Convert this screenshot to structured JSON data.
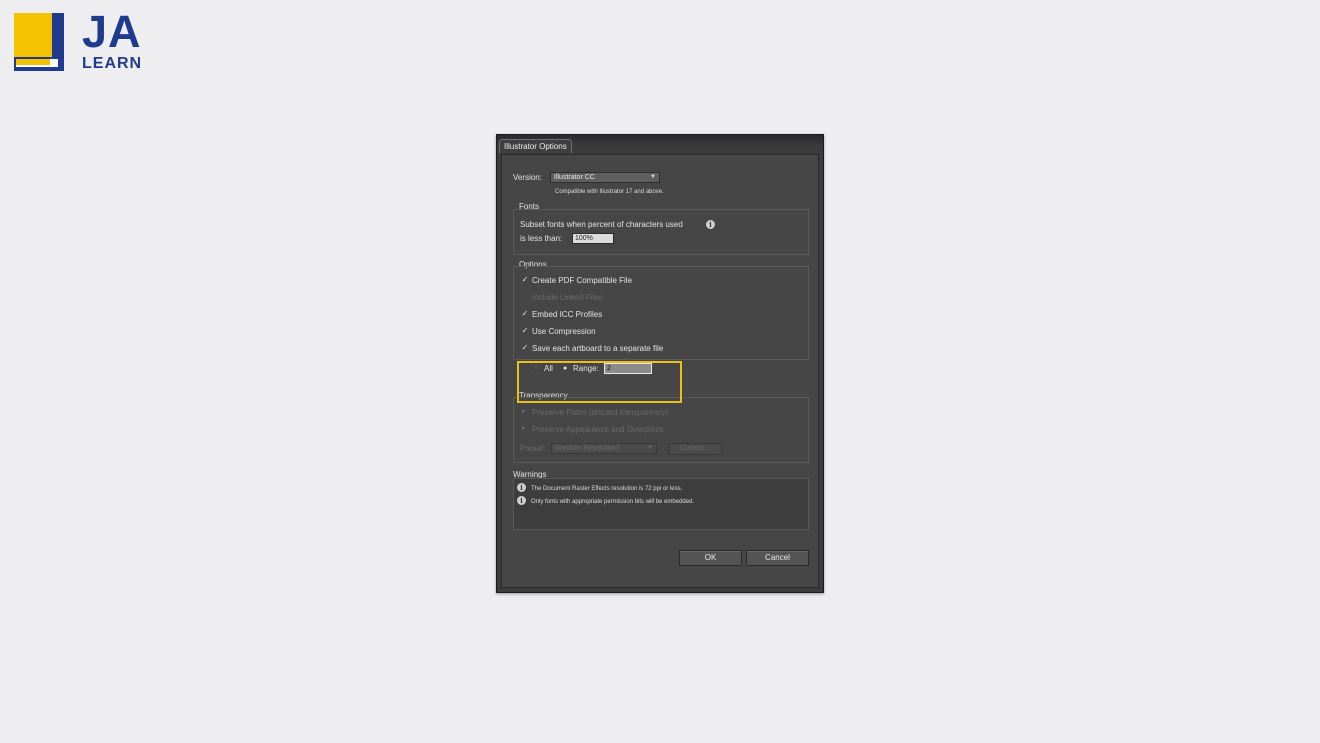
{
  "logo": {
    "ja": "JA",
    "learn": "LEARN",
    "colors": {
      "yellow": "#f5c200",
      "blue": "#1f3a8f"
    }
  },
  "dialog": {
    "title": "Illustrator Options",
    "version": {
      "label": "Version:",
      "selected": "Illustrator CC",
      "note": "Compatible with Illustrator 17 and above."
    },
    "fonts": {
      "group_label": "Fonts",
      "line1": "Subset fonts when percent of characters used",
      "line2": "is less than:",
      "value": "100%"
    },
    "options": {
      "group_label": "Options",
      "create_pdf": "Create PDF Compatible File",
      "include_linked": "Include Linked Files",
      "embed_icc": "Embed ICC Profiles",
      "use_compression": "Use Compression",
      "save_each_artboard": "Save each artboard to a separate file",
      "all_label": "All",
      "range_label": "Range:",
      "range_value": "2"
    },
    "transparency": {
      "group_label": "Transparency",
      "preserve_paths": "Preserve Paths (discard transparency)",
      "preserve_appearance": "Preserve Appearance and Overprints",
      "preset_label": "Preset:",
      "preset_value": "[Medium Resolution]",
      "custom_button": "Custom..."
    },
    "warnings": {
      "group_label": "Warnings",
      "items": [
        "The Document Raster Effects resolution is 72 ppi or less.",
        "Only fonts with appropriate permission bits will be embedded."
      ]
    },
    "ok_button": "OK",
    "cancel_button": "Cancel"
  }
}
